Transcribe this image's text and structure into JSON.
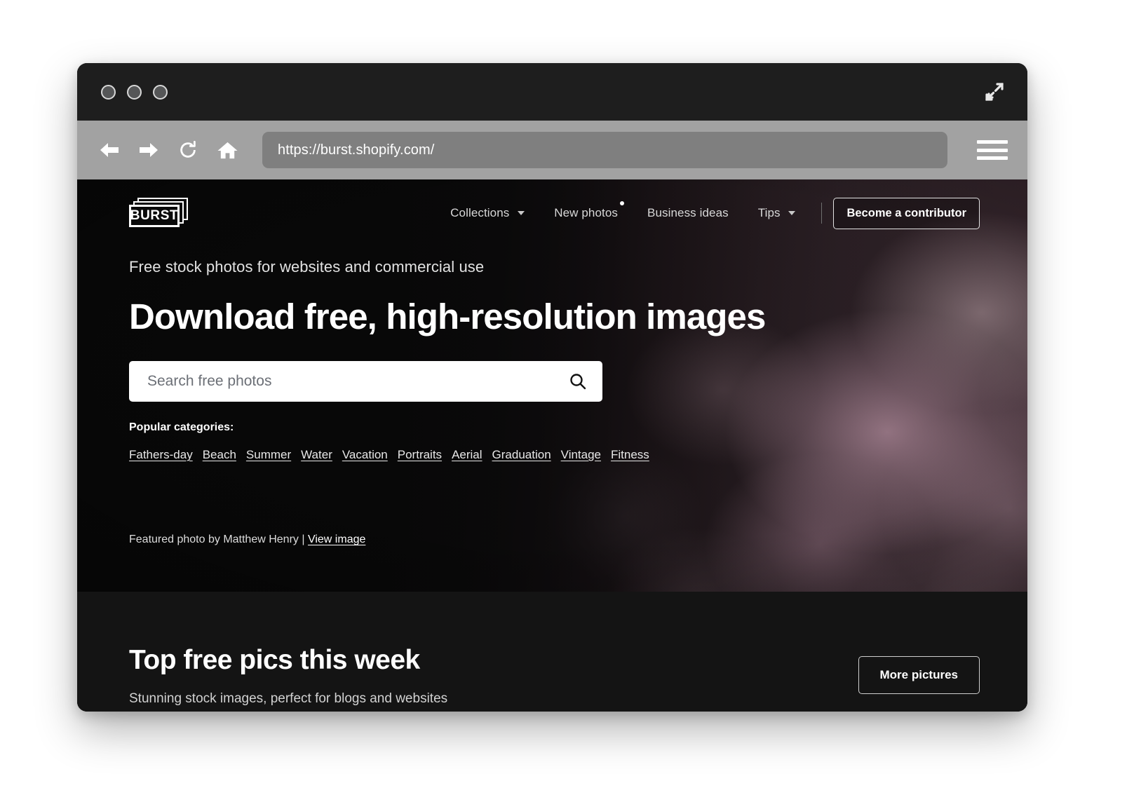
{
  "browser": {
    "url": "https://burst.shopify.com/",
    "back_icon": "back-arrow-icon",
    "forward_icon": "forward-arrow-icon",
    "reload_icon": "reload-icon",
    "home_icon": "home-icon",
    "menu_icon": "hamburger-menu-icon",
    "expand_icon": "expand-arrows-icon"
  },
  "site": {
    "logo_text": "BURST",
    "nav": [
      {
        "label": "Collections",
        "has_caret": true,
        "has_dot": false
      },
      {
        "label": "New photos",
        "has_caret": false,
        "has_dot": true
      },
      {
        "label": "Business ideas",
        "has_caret": false,
        "has_dot": false
      },
      {
        "label": "Tips",
        "has_caret": true,
        "has_dot": false
      }
    ],
    "contributor_button": "Become a contributor"
  },
  "hero": {
    "eyebrow": "Free stock photos for websites and commercial use",
    "headline": "Download free, high-resolution images",
    "search_placeholder": "Search free photos",
    "search_value": "",
    "search_icon": "magnifier-icon",
    "categories_label": "Popular categories:",
    "categories": [
      "Fathers-day",
      "Beach",
      "Summer",
      "Water",
      "Vacation",
      "Portraits",
      "Aerial",
      "Graduation",
      "Vintage",
      "Fitness"
    ],
    "credit_text": "Featured photo by Matthew Henry |",
    "credit_link": "View image"
  },
  "lower": {
    "title": "Top free pics this week",
    "subtitle": "Stunning stock images, perfect for blogs and websites",
    "more_button": "More pictures"
  },
  "colors": {
    "page_bg": "#141414",
    "toolbar_bg": "#a2a2a2",
    "titlebar_bg": "#1e1e1e",
    "urlbar_bg": "#7f7f7f",
    "accent_text": "#ffffff"
  }
}
